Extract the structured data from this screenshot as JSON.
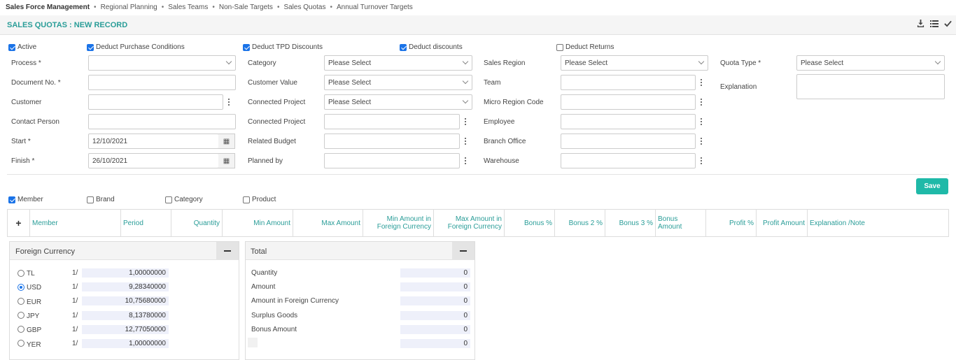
{
  "breadcrumb": {
    "root": "Sales Force Management",
    "items": [
      "Regional Planning",
      "Sales Teams",
      "Non-Sale Targets",
      "Sales Quotas",
      "Annual Turnover Targets"
    ]
  },
  "page": {
    "title": "SALES QUOTAS : NEW RECORD"
  },
  "header_icons": [
    "download-icon",
    "list-icon",
    "check-icon"
  ],
  "checks": {
    "active": {
      "label": "Active",
      "checked": true
    },
    "deduct_purchase": {
      "label": "Deduct Purchase Conditions",
      "checked": true
    },
    "deduct_tpd": {
      "label": "Deduct TPD Discounts",
      "checked": true
    },
    "deduct_discounts": {
      "label": "Deduct discounts",
      "checked": true
    },
    "deduct_returns": {
      "label": "Deduct Returns",
      "checked": false
    }
  },
  "form": {
    "process_label": "Process *",
    "process_value": "",
    "document_label": "Document No. *",
    "document_value": "",
    "customer_label": "Customer",
    "customer_value": "",
    "contact_label": "Contact Person",
    "contact_value": "",
    "start_label": "Start *",
    "start_value": "12/10/2021",
    "finish_label": "Finish *",
    "finish_value": "26/10/2021",
    "category_label": "Category",
    "category_value": "Please Select",
    "customer_value_label": "Customer Value",
    "customer_value_value": "Please Select",
    "connected_project_label": "Connected Project",
    "connected_project_value": "Please Select",
    "connected_project2_label": "Connected Project",
    "connected_project2_value": "",
    "related_budget_label": "Related Budget",
    "related_budget_value": "",
    "planned_by_label": "Planned by",
    "planned_by_value": "",
    "sales_region_label": "Sales Region",
    "sales_region_value": "Please Select",
    "team_label": "Team",
    "team_value": "",
    "micro_region_label": "Micro Region Code",
    "micro_region_value": "",
    "employee_label": "Employee",
    "employee_value": "",
    "branch_label": "Branch Office",
    "branch_value": "",
    "warehouse_label": "Warehouse",
    "warehouse_value": "",
    "quota_type_label": "Quota Type *",
    "quota_type_value": "Please Select",
    "explanation_label": "Explanation",
    "explanation_value": ""
  },
  "save_label": "Save",
  "grouping": {
    "member": {
      "label": "Member",
      "checked": true
    },
    "brand": {
      "label": "Brand",
      "checked": false
    },
    "category": {
      "label": "Category",
      "checked": false
    },
    "product": {
      "label": "Product",
      "checked": false
    }
  },
  "grid": {
    "add_icon": "plus-icon",
    "columns": [
      "Member",
      "Period",
      "Quantity",
      "Min Amount",
      "Max Amount",
      "Min Amount in Foreign Currency",
      "Max Amount in Foreign Currency",
      "Bonus %",
      "Bonus 2 %",
      "Bonus 3 %",
      "Bonus Amount",
      "Profit %",
      "Profit Amount",
      "Explanation /Note"
    ]
  },
  "foreign_currency": {
    "title": "Foreign Currency",
    "rows": [
      {
        "code": "TL",
        "prefix": "1/",
        "rate": "1,00000000",
        "selected": false
      },
      {
        "code": "USD",
        "prefix": "1/",
        "rate": "9,28340000",
        "selected": true
      },
      {
        "code": "EUR",
        "prefix": "1/",
        "rate": "10,75680000",
        "selected": false
      },
      {
        "code": "JPY",
        "prefix": "1/",
        "rate": "8,13780000",
        "selected": false
      },
      {
        "code": "GBP",
        "prefix": "1/",
        "rate": "12,77050000",
        "selected": false
      },
      {
        "code": "YER",
        "prefix": "1/",
        "rate": "1,00000000",
        "selected": false
      }
    ]
  },
  "total": {
    "title": "Total",
    "rows": [
      {
        "label": "Quantity",
        "value": "0"
      },
      {
        "label": "Amount",
        "value": "0"
      },
      {
        "label": "Amount in Foreign Currency",
        "value": "0"
      },
      {
        "label": "Surplus Goods",
        "value": "0"
      },
      {
        "label": "Bonus Amount",
        "value": "0"
      },
      {
        "label": "",
        "value": "0"
      }
    ]
  }
}
